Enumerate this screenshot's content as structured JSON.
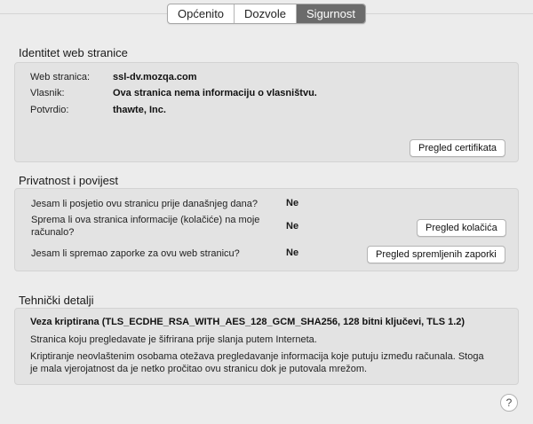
{
  "tabs": [
    {
      "label": "Općenito",
      "active": false
    },
    {
      "label": "Dozvole",
      "active": false
    },
    {
      "label": "Sigurnost",
      "active": true
    }
  ],
  "identity": {
    "title": "Identitet web stranice",
    "rows": [
      {
        "label": "Web stranica:",
        "value": "ssl-dv.mozqa.com"
      },
      {
        "label": "Vlasnik:",
        "value": "Ova stranica nema informaciju o vlasništvu."
      },
      {
        "label": "Potvrdio:",
        "value": "thawte, Inc."
      }
    ],
    "button": "Pregled certifikata"
  },
  "privacy": {
    "title": "Privatnost i povijest",
    "rows": [
      {
        "question": "Jesam li posjetio ovu stranicu prije današnjeg dana?",
        "answer": "Ne"
      },
      {
        "question_line1": "Sprema li ova stranica informacije (kolačiće) na moje",
        "question_line2": "računalo?",
        "answer": "Ne",
        "button": "Pregled kolačića"
      },
      {
        "question": "Jesam li spremao zaporke za ovu web stranicu?",
        "answer": "Ne",
        "button": "Pregled spremljenih zaporki"
      }
    ]
  },
  "technical": {
    "title": "Tehnički detalji",
    "connection": "Veza kriptirana (TLS_ECDHE_RSA_WITH_AES_128_GCM_SHA256, 128 bitni ključevi, TLS 1.2)",
    "line1": "Stranica koju pregledavate je šifrirana prije slanja putem Interneta.",
    "line2": "Kriptiranje neovlaštenim osobama otežava pregledavanje informacija koje putuju između računala. Stoga",
    "line3": "je mala vjerojatnost da je netko pročitao ovu stranicu dok je putovala mrežom."
  },
  "help": {
    "label": "?"
  }
}
